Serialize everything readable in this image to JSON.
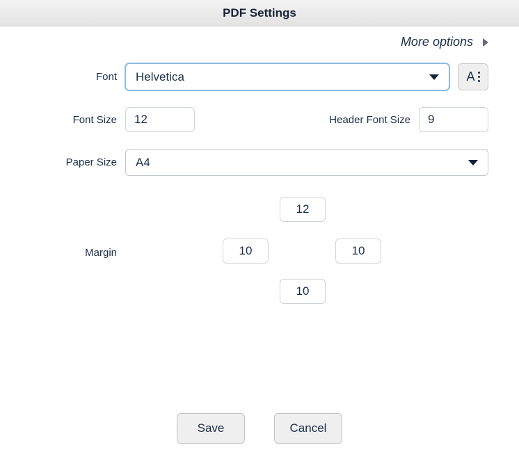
{
  "title": "PDF Settings",
  "more_options": "More options",
  "labels": {
    "font": "Font",
    "font_size": "Font Size",
    "header_font_size": "Header Font Size",
    "paper_size": "Paper Size",
    "margin": "Margin"
  },
  "font": {
    "selected": "Helvetica",
    "extra_btn_glyph": "A"
  },
  "font_size": "12",
  "header_font_size": "9",
  "paper_size": {
    "selected": "A4"
  },
  "margin": {
    "top": "12",
    "left": "10",
    "right": "10",
    "bottom": "10"
  },
  "buttons": {
    "save": "Save",
    "cancel": "Cancel"
  }
}
